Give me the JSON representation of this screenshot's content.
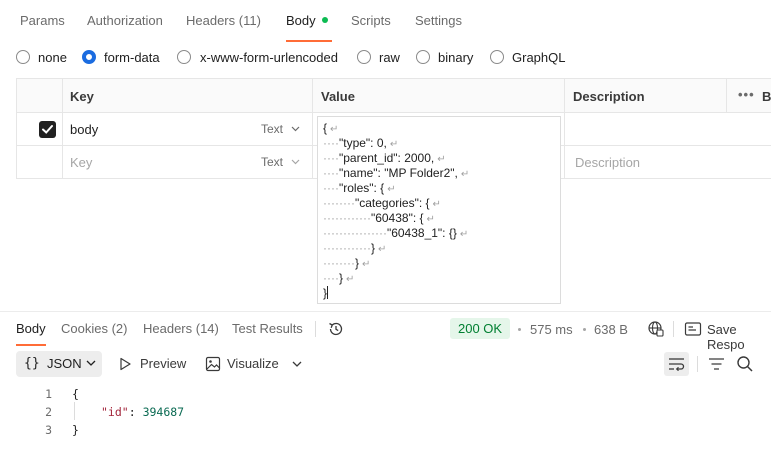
{
  "request_tabs": {
    "params": "Params",
    "authorization": "Authorization",
    "headers": "Headers (11)",
    "body": "Body",
    "scripts": "Scripts",
    "settings": "Settings"
  },
  "body_types": {
    "none": "none",
    "form_data": "form-data",
    "urlencoded": "x-www-form-urlencoded",
    "raw": "raw",
    "binary": "binary",
    "graphql": "GraphQL",
    "selected": "form-data"
  },
  "form_table": {
    "headers": {
      "key": "Key",
      "value": "Value",
      "description": "Description",
      "bulk": "B"
    },
    "rows": [
      {
        "checked": true,
        "key": "body",
        "type": "Text"
      }
    ],
    "placeholder": {
      "key": "Key",
      "type": "Text",
      "description": "Description"
    }
  },
  "value_editor": {
    "lines": [
      "{",
      "\"type\": 0,",
      "\"parent_id\": 2000,",
      "\"name\": \"MP Folder2\",",
      "\"roles\": {",
      "\"categories\": {",
      "\"60438\": {",
      "\"60438_1\": {}",
      "}",
      "}",
      "}",
      "}"
    ]
  },
  "response": {
    "tabs": {
      "body": "Body",
      "cookies": "Cookies (2)",
      "headers": "Headers (14)",
      "test_results": "Test Results"
    },
    "status": "200 OK",
    "time": "575 ms",
    "size": "638 B",
    "save_label": "Save Respo",
    "format": "JSON",
    "preview_label": "Preview",
    "visualize_label": "Visualize",
    "code": {
      "line_numbers": [
        "1",
        "2",
        "3"
      ],
      "open_brace": "{",
      "key": "\"id\"",
      "colon": ": ",
      "value": "394687",
      "close_brace": "}"
    }
  },
  "colors": {
    "accent": "#ff6c37",
    "radio_selected": "#1b6ce0",
    "status_green": "#007f31",
    "status_bg": "#e5f6ea",
    "tab_dot": "#0cbb52"
  }
}
